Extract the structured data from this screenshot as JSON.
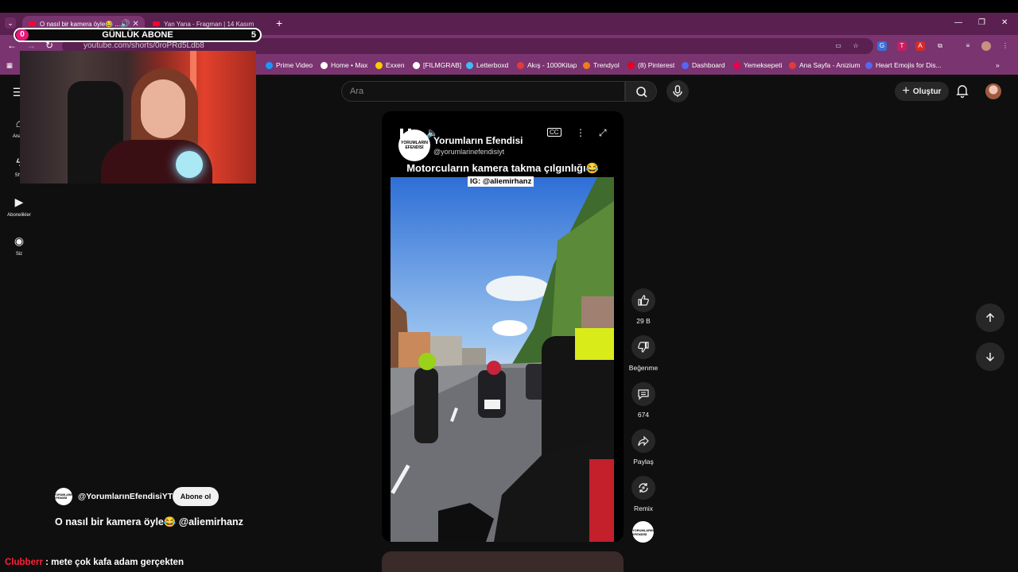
{
  "browser": {
    "tabs": [
      {
        "title": "O nasıl bir kamera öyle😂 ...",
        "active": true
      },
      {
        "title": "Yan Yana - Fragman | 14 Kasım",
        "active": false
      }
    ],
    "url": "youtube.com/shorts/0roPRd5Ldb8",
    "bookmarks": [
      {
        "label": "Prime Video",
        "color": "#1a98ff"
      },
      {
        "label": "Home • Max",
        "color": "#ffffff"
      },
      {
        "label": "Exxen",
        "color": "#ffcc00"
      },
      {
        "label": "[FILMGRAB]",
        "color": "#ffffff"
      },
      {
        "label": "Letterboxd",
        "color": "#40bcf4"
      },
      {
        "label": "Akış - 1000Kitap",
        "color": "#e23a3a"
      },
      {
        "label": "Trendyol",
        "color": "#f27a1a"
      },
      {
        "label": "(8) Pinterest",
        "color": "#e60023"
      },
      {
        "label": "Dashboard",
        "color": "#5865f2"
      },
      {
        "label": "Yemeksepeti",
        "color": "#ea004b"
      },
      {
        "label": "Ana Sayfa - Anizium",
        "color": "#e23a3a"
      },
      {
        "label": "Heart Emojis for Dis...",
        "color": "#5865f2"
      }
    ]
  },
  "overlay": {
    "sub_counter": {
      "current": "0",
      "title": "GÜNLÜK ABONE",
      "goal": "5"
    },
    "chat": {
      "user": "Clubberr",
      "message": " : mete çok kafa adam gerçekten"
    }
  },
  "sidebar": {
    "items": [
      {
        "label": "Ana S",
        "icon": "home-icon"
      },
      {
        "label": "Sho",
        "icon": "shorts-icon"
      },
      {
        "label": "Abonelikler",
        "icon": "subscriptions-icon"
      },
      {
        "label": "Siz",
        "icon": "user-icon"
      }
    ]
  },
  "header": {
    "search_placeholder": "Ara",
    "create_label": "Oluştur"
  },
  "short": {
    "channel": "Yorumların Efendisi",
    "handle": "@yorumlarinefendisiyt",
    "caption": "Motorcuların kamera takma çılgınlığı😂",
    "ig_tag": "IG: @aliemirhanz",
    "logo_text": "YORUMLARIN EFENDİSİ",
    "actions": {
      "likes": "29 B",
      "dislike_label": "Beğenme",
      "comments": "674",
      "share_label": "Paylaş",
      "remix_label": "Remix"
    },
    "info": {
      "channel_handle": "@YorumlarınEfendisiYT",
      "subscribe_label": "Abone ol",
      "title": "O nasıl bir kamera öyle😂 @aliemirhanz"
    }
  },
  "colors": {
    "browser_frame": "#7a3470",
    "accent_pink": "#e6197a",
    "chat_user": "#ff1f3a"
  }
}
